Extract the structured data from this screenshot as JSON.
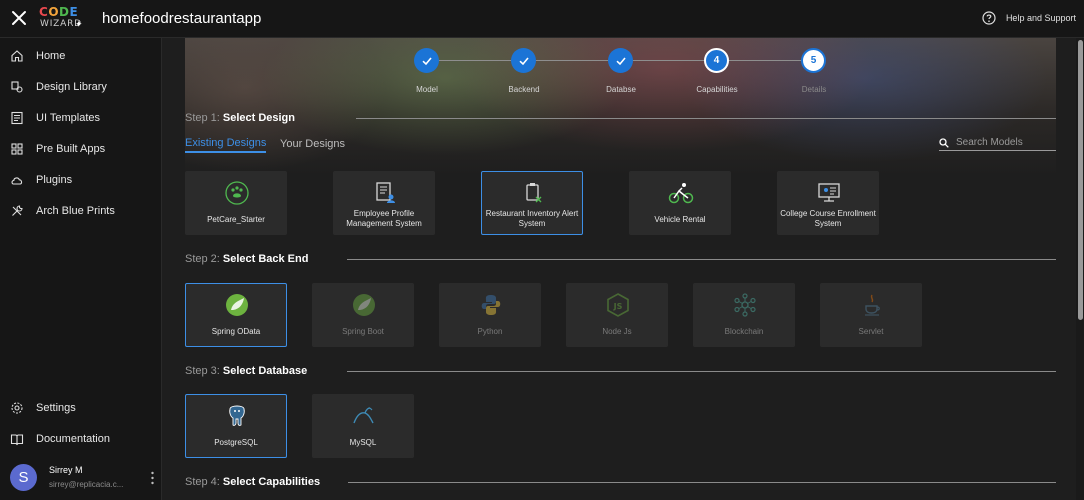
{
  "header": {
    "logo_line1": "CODE",
    "logo_line2": "WIZARD",
    "app_title": "homefoodrestaurantapp",
    "help_label": "Help and Support"
  },
  "sidebar": {
    "items": [
      {
        "label": "Home",
        "icon": "home-icon"
      },
      {
        "label": "Design Library",
        "icon": "library-icon"
      },
      {
        "label": "UI Templates",
        "icon": "templates-icon"
      },
      {
        "label": "Pre Built Apps",
        "icon": "grid-icon"
      },
      {
        "label": "Plugins",
        "icon": "cloud-icon"
      },
      {
        "label": "Arch Blue Prints",
        "icon": "tools-icon"
      }
    ],
    "bottom_items": [
      {
        "label": "Settings",
        "icon": "gear-icon"
      },
      {
        "label": "Documentation",
        "icon": "book-icon"
      }
    ],
    "user": {
      "initial": "S",
      "name": "Sirrey M",
      "email": "sirrey@replicacia.c..."
    }
  },
  "stepper": {
    "steps": [
      {
        "label": "Model",
        "state": "done"
      },
      {
        "label": "Backend",
        "state": "done"
      },
      {
        "label": "Databse",
        "state": "done"
      },
      {
        "label": "Capabilities",
        "state": "current",
        "number": "4"
      },
      {
        "label": "Details",
        "state": "todo",
        "number": "5"
      }
    ]
  },
  "step1": {
    "prefix": "Step 1:",
    "title": "Select Design",
    "tabs": [
      {
        "label": "Existing Designs",
        "active": true
      },
      {
        "label": "Your Designs",
        "active": false
      }
    ],
    "search_placeholder": "Search Models",
    "cards": [
      {
        "label": "PetCare_Starter",
        "icon": "pet-care-icon"
      },
      {
        "label": "Employee Profile Management System",
        "icon": "employee-profile-icon"
      },
      {
        "label": "Restaurant Inventory Alert System",
        "icon": "inventory-alert-icon",
        "selected": true
      },
      {
        "label": "Vehicle Rental",
        "icon": "bicycle-icon"
      },
      {
        "label": "College Course Enrollment System",
        "icon": "course-enrollment-icon"
      }
    ]
  },
  "step2": {
    "prefix": "Step 2:",
    "title": "Select Back End",
    "cards": [
      {
        "label": "Spring OData",
        "icon": "spring-icon",
        "selected": true
      },
      {
        "label": "Spring Boot",
        "icon": "spring-icon",
        "disabled": true
      },
      {
        "label": "Python",
        "icon": "python-icon",
        "disabled": true
      },
      {
        "label": "Node Js",
        "icon": "nodejs-icon",
        "disabled": true
      },
      {
        "label": "Blockchain",
        "icon": "blockchain-icon",
        "disabled": true
      },
      {
        "label": "Servlet",
        "icon": "java-icon",
        "disabled": true
      }
    ]
  },
  "step3": {
    "prefix": "Step 3:",
    "title": "Select Database",
    "cards": [
      {
        "label": "PostgreSQL",
        "icon": "postgresql-icon",
        "selected": true
      },
      {
        "label": "MySQL",
        "icon": "mysql-icon"
      }
    ]
  },
  "step4": {
    "prefix": "Step 4:",
    "title": "Select Capabilities"
  },
  "colors": {
    "accent": "#1b74d6",
    "link": "#3d8fe6",
    "background": "#1e1e1e",
    "card": "#2b2b2b"
  }
}
